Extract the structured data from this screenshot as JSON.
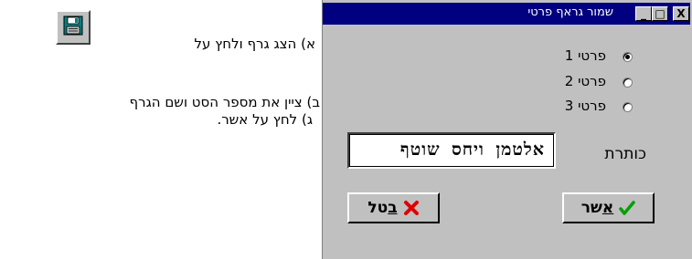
{
  "instructions": {
    "step_a": "א) הצג גרף ולחץ על",
    "step_b": "ב) ציין את מספר הסט ושם הגרף",
    "step_c": "ג) לחץ על אשר."
  },
  "dialog": {
    "title": "שמור גראף פרטי",
    "titlebar_buttons": {
      "minimize": "_",
      "maximize": "□",
      "close": "X"
    },
    "options": [
      {
        "label": "פרטי 1",
        "selected": true
      },
      {
        "label": "פרטי 2",
        "selected": false
      },
      {
        "label": "פרטי 3",
        "selected": false
      }
    ],
    "caption_label": "כותרת",
    "caption_value": "אלטמן ויחס שוטף",
    "ok_button": {
      "accel": "א",
      "rest": "שר"
    },
    "cancel_button": {
      "accel": "ב",
      "rest": "טל"
    }
  },
  "colors": {
    "titlebar": "#000080",
    "dialog_bg": "#c0c0c0",
    "ok_check": "#00a000",
    "cancel_x": "#e00000"
  },
  "icons": [
    "floppy-save-icon",
    "checkmark-icon",
    "cancel-x-icon",
    "radio-button-icon"
  ]
}
